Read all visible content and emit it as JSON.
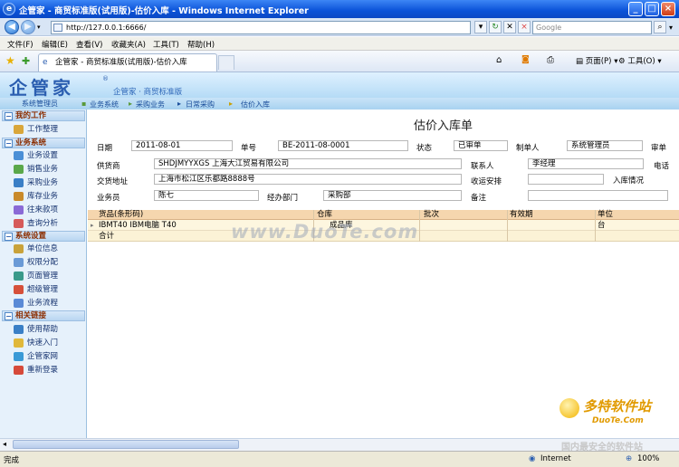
{
  "window": {
    "title": "企管家 - 商贸标准版(试用版)-估价入库 - Windows Internet Explorer",
    "buttons": {
      "minimize": "_",
      "maximize": "□",
      "close": "×"
    }
  },
  "addressbar": {
    "url": "http://127.0.0.1:6666/",
    "search_placeholder": "Google"
  },
  "menu": [
    "文件(F)",
    "编辑(E)",
    "查看(V)",
    "收藏夹(A)",
    "工具(T)",
    "帮助(H)"
  ],
  "tab": {
    "label": "企管家 - 商贸标准版(试用版)-估价入库"
  },
  "ie_toolbar": {
    "page": "页面(P)",
    "tools": "工具(O)"
  },
  "app": {
    "logo": "企管家",
    "subtitle": "企管家 · 商贸标准版",
    "user": "系统管理员",
    "breadcrumbs": [
      "业务系统",
      "采购业务",
      "日常采购",
      "估价入库"
    ]
  },
  "sidebar": {
    "sections": [
      {
        "title": "我的工作",
        "items": [
          "工作整理"
        ]
      },
      {
        "title": "业务系统",
        "items": [
          "业务设置",
          "销售业务",
          "采购业务",
          "库存业务",
          "往来款项",
          "查询分析"
        ]
      },
      {
        "title": "系统设置",
        "items": [
          "单位信息",
          "权限分配",
          "页面管理",
          "超级管理",
          "业务流程"
        ]
      },
      {
        "title": "相关链接",
        "items": [
          "使用帮助",
          "快速入门",
          "企管家网",
          "重新登录"
        ]
      }
    ]
  },
  "form": {
    "title": "估价入库单",
    "date_label": "日期",
    "date": "2011-08-01",
    "no_label": "单号",
    "no": "BE-2011-08-0001",
    "status_label": "状态",
    "status": "已审单",
    "creator_label": "制单人",
    "creator": "系统管理员",
    "reviewer_label": "审单",
    "supplier_label": "供货商",
    "supplier": "SHDJMYYXGS 上海大江贸易有限公司",
    "contact_label": "联系人",
    "contact": "李经理",
    "phone_label": "电话",
    "address_label": "交货地址",
    "address": "上海市松江区乐都路8888号",
    "receive_label": "收运安排",
    "receive": "",
    "instock_label": "入库情况",
    "clerk_label": "业务员",
    "clerk": "陈七",
    "dept_label": "经办部门",
    "dept": "采购部",
    "remark_label": "备注",
    "remark": ""
  },
  "table": {
    "columns": [
      "货品(条形码)",
      "仓库",
      "批次",
      "有效期",
      "单位"
    ],
    "rows": [
      {
        "goods": "IBMT40 IBM电脑 T40",
        "warehouse": "成品库",
        "batch": "",
        "expiry": "",
        "unit": "台"
      }
    ],
    "total_label": "合计"
  },
  "watermark": "www.DuoTe.com",
  "status": {
    "left": "完成",
    "zone": "Internet",
    "zoom": "100%"
  },
  "brand_logo": {
    "name": "多特软件站",
    "url": "DuoTe.Com",
    "slogan": "国内最安全的软件站"
  }
}
